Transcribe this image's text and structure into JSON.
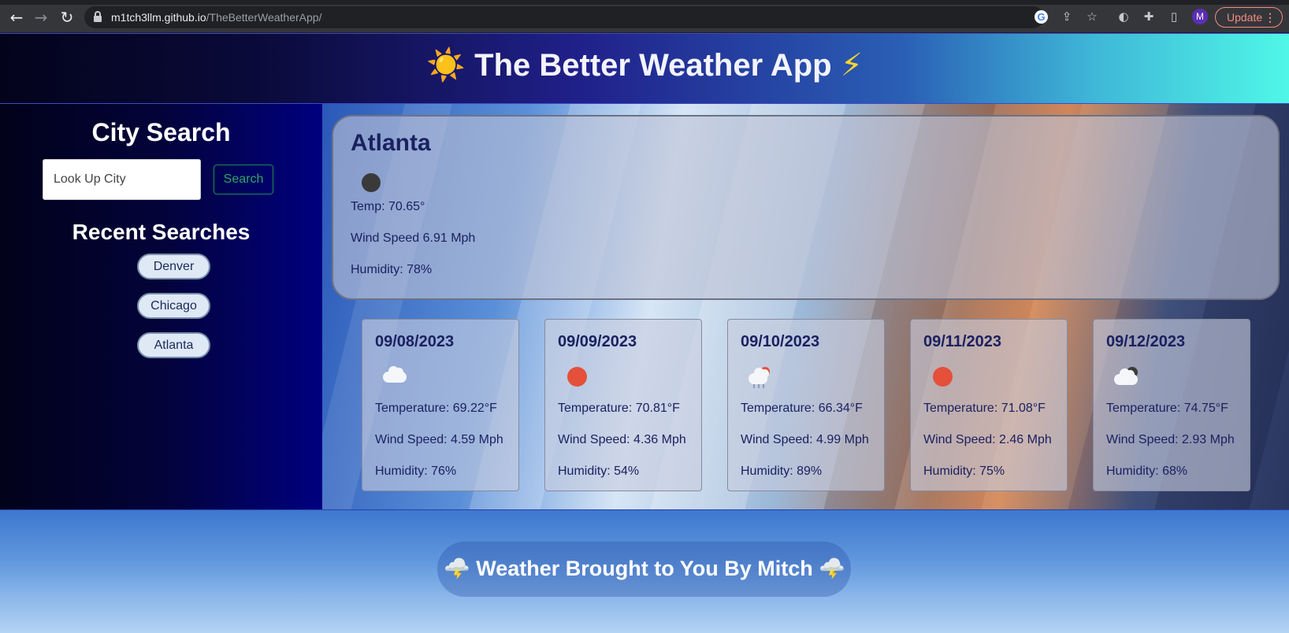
{
  "browser": {
    "url_host": "m1tch3llm.github.io",
    "url_path": "/TheBetterWeatherApp/",
    "update_label": "Update",
    "avatar_letter": "M"
  },
  "header": {
    "title": "The Better Weather App",
    "left_icon": "☀️",
    "right_icon": "⚡"
  },
  "sidebar": {
    "city_search_title": "City Search",
    "search_placeholder": "Look Up City",
    "search_button": "Search",
    "recent_title": "Recent Searches",
    "recent": [
      "Denver",
      "Chicago",
      "Atlanta"
    ]
  },
  "current": {
    "city": "Atlanta",
    "icon": "night-clear",
    "temp": "Temp: 70.65°",
    "wind": "Wind Speed 6.91 Mph",
    "humidity": "Humidity: 78%"
  },
  "forecast": [
    {
      "date": "09/08/2023",
      "icon": "cloud",
      "temperature": "Temperature: 69.22°F",
      "wind": "Wind Speed: 4.59 Mph",
      "humidity": "Humidity: 76%"
    },
    {
      "date": "09/09/2023",
      "icon": "sun",
      "temperature": "Temperature: 70.81°F",
      "wind": "Wind Speed: 4.36 Mph",
      "humidity": "Humidity: 54%"
    },
    {
      "date": "09/10/2023",
      "icon": "rain",
      "temperature": "Temperature: 66.34°F",
      "wind": "Wind Speed: 4.99 Mph",
      "humidity": "Humidity: 89%"
    },
    {
      "date": "09/11/2023",
      "icon": "sun",
      "temperature": "Temperature: 71.08°F",
      "wind": "Wind Speed: 2.46 Mph",
      "humidity": "Humidity: 75%"
    },
    {
      "date": "09/12/2023",
      "icon": "broken-clouds",
      "temperature": "Temperature: 74.75°F",
      "wind": "Wind Speed: 2.93 Mph",
      "humidity": "Humidity: 68%"
    }
  ],
  "footer": {
    "text": "Weather Brought to You By Mitch",
    "icon": "🌩️"
  }
}
